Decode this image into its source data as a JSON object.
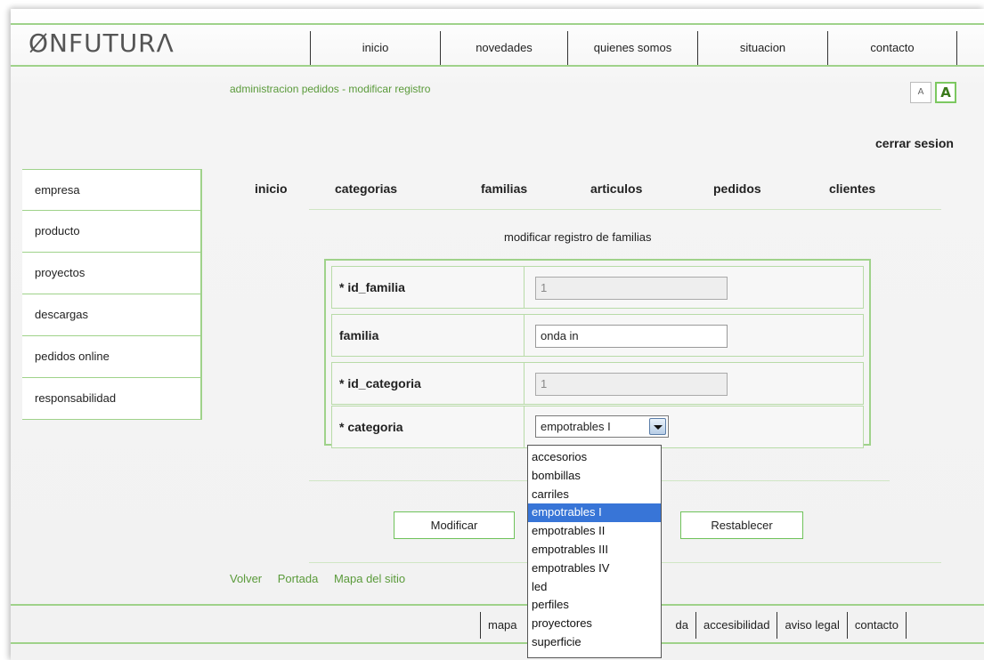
{
  "logo": "ØNFUTURΛ",
  "topnav": [
    "inicio",
    "novedades",
    "quienes somos",
    "situacion",
    "contacto"
  ],
  "breadcrumb": "administracion pedidos - modificar registro",
  "font_controls": {
    "decrease": "A",
    "increase": "A"
  },
  "logout": "cerrar sesion",
  "sidebar": [
    "empresa",
    "producto",
    "proyectos",
    "descargas",
    "pedidos online",
    "responsabilidad"
  ],
  "subnav": [
    "inicio",
    "categorias",
    "familias",
    "articulos",
    "pedidos",
    "clientes"
  ],
  "form": {
    "title": "modificar registro de familias",
    "fields": [
      {
        "label": "* id_familia",
        "value": "1",
        "disabled": true
      },
      {
        "label": "familia",
        "value": "onda in",
        "disabled": false
      },
      {
        "label": "* id_categoria",
        "value": "1",
        "disabled": true
      },
      {
        "label": "* categoria",
        "value": "empotrables I"
      }
    ],
    "category_options": [
      "accesorios",
      "bombillas",
      "carriles",
      "empotrables I",
      "empotrables II",
      "empotrables III",
      "empotrables IV",
      "led",
      "perfiles",
      "proyectores",
      "superficie"
    ],
    "selected_option": "empotrables I"
  },
  "buttons": {
    "modify": "Modificar",
    "reset": "Restablecer"
  },
  "footer_links": [
    "Volver",
    "Portada",
    "Mapa del sitio"
  ],
  "footer_nav": [
    "mapa",
    "da",
    "accesibilidad",
    "aviso legal",
    "contacto"
  ],
  "colors": {
    "accent": "#9fd28a",
    "link_green": "#5a9a3a",
    "selection": "#3875d7"
  }
}
